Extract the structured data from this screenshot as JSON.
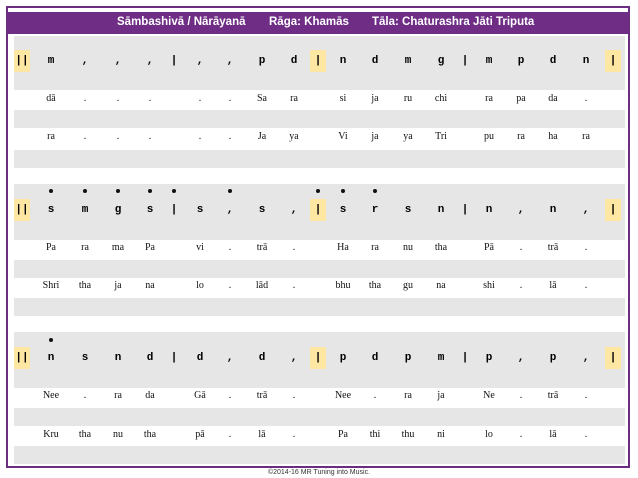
{
  "header": {
    "composer": "Sāmbashivā / Nārāyanā",
    "raga": "Rāga:  Khamās",
    "tala": "Tāla:  Chaturashra Jāti Triputa"
  },
  "sections": [
    {
      "dots": [],
      "swaras": [
        "||",
        "m",
        ",",
        ",",
        ",",
        "|",
        ",",
        ",",
        "p",
        "d",
        "|",
        "n",
        "d",
        "m",
        "g",
        "|",
        "m",
        "p",
        "d",
        "n",
        "|"
      ],
      "lyrics1": [
        "dā",
        ".",
        ".",
        ".",
        ".",
        ".",
        "Sa",
        "ra",
        "si",
        "ja",
        "ru",
        "chi",
        "ra",
        "pa",
        "da",
        "."
      ],
      "lyrics2": [
        "ra",
        ".",
        ".",
        ".",
        ".",
        ".",
        "Ja",
        "ya",
        "Vi",
        "ja",
        "ya",
        "Tri",
        "pu",
        "ra",
        "ha",
        "ra"
      ]
    },
    {
      "dots": [
        1,
        2,
        3,
        4,
        5,
        7,
        10,
        11,
        12
      ],
      "swaras": [
        "||",
        "s",
        "m",
        "g",
        "s",
        "|",
        "s",
        ",",
        "s",
        ",",
        "|",
        "s",
        "r",
        "s",
        "n",
        "|",
        "n",
        ",",
        "n",
        ",",
        "|"
      ],
      "lyrics1": [
        "Pa",
        "ra",
        "ma",
        "Pa",
        "vi",
        ".",
        "trā",
        ".",
        "Ha",
        "ra",
        "nu",
        "tha",
        "Pā",
        ".",
        "trā",
        "."
      ],
      "lyrics2": [
        "Shri",
        "tha",
        "ja",
        "na",
        "lo",
        ".",
        "lād",
        ".",
        "bhu",
        "tha",
        "gu",
        "na",
        "shi",
        ".",
        "lā",
        "."
      ]
    },
    {
      "dots": [
        1
      ],
      "swaras": [
        "||",
        "n",
        "s",
        "n",
        "d",
        "|",
        "d",
        ",",
        "d",
        ",",
        "|",
        "p",
        "d",
        "p",
        "m",
        "|",
        "p",
        ",",
        "p",
        ",",
        "|"
      ],
      "lyrics1": [
        "Nee",
        ".",
        "ra",
        "da",
        "Gā",
        ".",
        "trā",
        ".",
        "Nee",
        ".",
        "ra",
        "ja",
        "Ne",
        ".",
        "trā",
        "."
      ],
      "lyrics2": [
        "Kru",
        "tha",
        "nu",
        "tha",
        "pā",
        ".",
        "lā",
        ".",
        "Pa",
        "thi",
        "thu",
        "ni",
        "lo",
        ".",
        "lā",
        "."
      ]
    }
  ],
  "footer": "©2014-16 MR Tuning into Music."
}
